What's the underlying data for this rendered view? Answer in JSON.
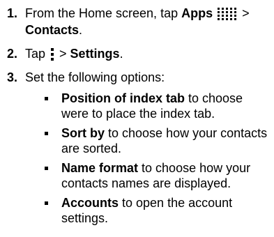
{
  "steps": [
    {
      "num": "1.",
      "pre": "From the Home screen, tap ",
      "bold1": "Apps",
      "icon": "apps-grid-icon",
      "sep": " >",
      "bold2": "Contacts",
      "post": "."
    },
    {
      "num": "2.",
      "pre": "Tap ",
      "icon": "more-options-icon",
      "sep": " > ",
      "bold": "Settings",
      "post": "."
    },
    {
      "num": "3.",
      "text": "Set the following options:"
    }
  ],
  "options": [
    {
      "bold": "Position of index tab",
      "line1": " to choose",
      "line2": "were to place the index tab."
    },
    {
      "bold": "Sort by",
      "line1": " to choose how your contacts",
      "line2": "are sorted."
    },
    {
      "bold": "Name format",
      "line1": " to choose how your",
      "line2": "contacts names are displayed."
    },
    {
      "bold": "Accounts",
      "line1": " to open the account",
      "line2": "settings."
    }
  ]
}
